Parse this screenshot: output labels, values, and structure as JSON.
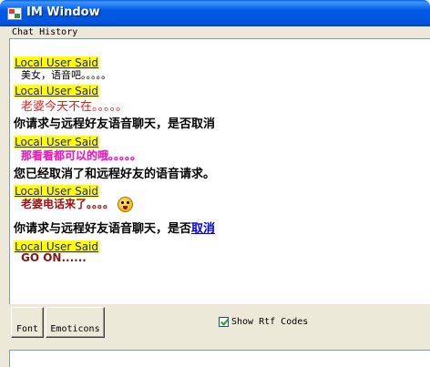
{
  "window": {
    "title": "IM Window"
  },
  "chat_history": {
    "label": "Chat History",
    "messages": [
      {
        "sender": "Local User Said",
        "text": "美女，语音吧。。。。。"
      },
      {
        "sender": "Local User Said",
        "text": "老婆今天不在。。。。。"
      },
      {
        "system": "你请求与远程好友语音聊天，是否取消"
      },
      {
        "sender": "Local User Said",
        "text": "那看看都可以的哦。。。。。"
      },
      {
        "system": "您已经取消了和远程好友的语音请求。"
      },
      {
        "sender": "Local User Said",
        "text": "老婆电话来了。。。。",
        "emoticon": "smiley-icon"
      },
      {
        "system_prefix": "你请求与远程好友语音聊天，是否",
        "link": "取消"
      },
      {
        "sender": "Local User Said",
        "text": "GO ON......"
      }
    ]
  },
  "toolbar": {
    "font_label": "Font",
    "emoticons_label": "Emoticons",
    "show_rtf_label": "Show Rtf Codes",
    "show_rtf_checked": true
  },
  "input": {
    "value": ""
  },
  "colors": {
    "said_background": "#FFFF00",
    "said_text": "#1E1EA0",
    "message_red": "#D22222",
    "message_pink": "#E020C0",
    "link": "#0000EE"
  }
}
